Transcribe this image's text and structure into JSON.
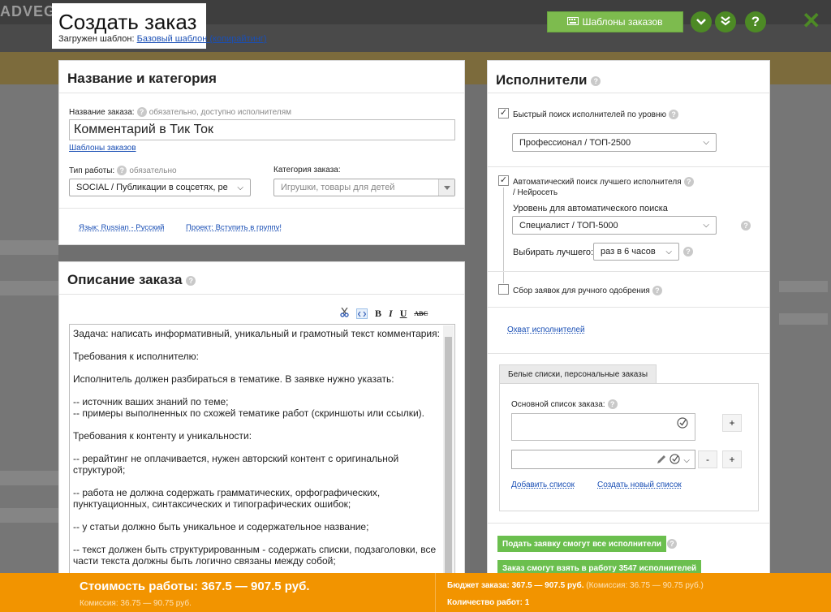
{
  "background": {
    "logo": "ADVEGO"
  },
  "header": {
    "title": "Создать заказ",
    "template_label": "Загружен шаблон:",
    "template_link": "Базовый шаблон (копирайтинг)",
    "templates_button": "Шаблоны заказов",
    "expand_icon": "chevron-down-icon",
    "expand_all_icon": "double-chevron-down-icon",
    "help_symbol": "?",
    "close_symbol": "✕"
  },
  "name_panel": {
    "heading": "Название и категория",
    "order_name_label": "Название заказа:",
    "order_name_hint": "обязательно, доступно исполнителям",
    "order_name_value": "Комментарий в Тик Ток",
    "templates_link": "Шаблоны заказов",
    "work_type_label": "Тип работы:",
    "work_type_hint": "обязательно",
    "work_type_value": "SOCIAL / Публикации в соцсетях, ре",
    "category_label": "Категория заказа:",
    "category_placeholder": "Игрушки, товары для детей",
    "language_link": "Язык: Russian - Русский",
    "project_link": "Проект: Вступить в группу!"
  },
  "description_panel": {
    "heading": "Описание заказа",
    "toolbar": {
      "bold": "B",
      "italic": "I",
      "underline": "U",
      "strike": "ABC"
    },
    "lines": [
      "Задача: написать информативный, уникальный и грамотный текст комментария:",
      "",
      "Требования к исполнителю:",
      "",
      "Исполнитель должен разбираться в тематике. В заявке нужно указать:",
      "",
      "-- источник ваших знаний по теме;",
      "-- примеры выполненных по схожей тематике работ (скриншоты или ссылки).",
      "",
      "Требования к контенту и уникальности:",
      "",
      "-- рерайтинг не оплачивается, нужен авторский контент с оригинальной",
      "структурой;",
      "",
      "-- работа не должна содержать грамматических, орфографических,",
      "пунктуационных, синтаксических и типографических ошибок;",
      "",
      "-- у статьи должно быть уникальное и содержательное название;",
      "",
      "-- текст должен быть структурированным - содержать списки, подзаголовки, все",
      "части текста должны быть логично связаны между собой;"
    ]
  },
  "executors_panel": {
    "heading": "Исполнители",
    "quick_search_label": "Быстрый поиск исполнителей по уровню",
    "quick_search_level": "Профессионал / ТОП-2500",
    "auto_search_label": "Автоматический поиск лучшего исполнителя",
    "auto_search_label2": "/ Нейросеть",
    "auto_level_label": "Уровень для автоматического поиска",
    "auto_level_value": "Специалист / ТОП-5000",
    "choose_best_label": "Выбирать лучшего:",
    "choose_best_value": "раз в 6 часов",
    "manual_collect_label": "Сбор заявок для ручного одобрения",
    "coverage_link": "Охват исполнителей",
    "whitelist_tab": "Белые списки, персональные заказы",
    "main_list_label": "Основной список заказа:",
    "add_list_link": "Добавить список",
    "create_list_link": "Создать новый список",
    "plus": "+",
    "minus": "-",
    "all_can_apply": "Подать заявку смогут все исполнители",
    "can_take": "Заказ смогут взять в работу 3547 исполнителей"
  },
  "footer": {
    "cost": "Стоимость работы: 367.5 — 907.5 руб.",
    "commission": "Комиссия: 36.75 — 90.75 руб.",
    "budget": "Бюджет заказа: 367.5 — 907.5 руб.",
    "budget_commission": "(Комиссия: 36.75 — 90.75 руб.)",
    "quantity": "Количество работ: 1"
  }
}
